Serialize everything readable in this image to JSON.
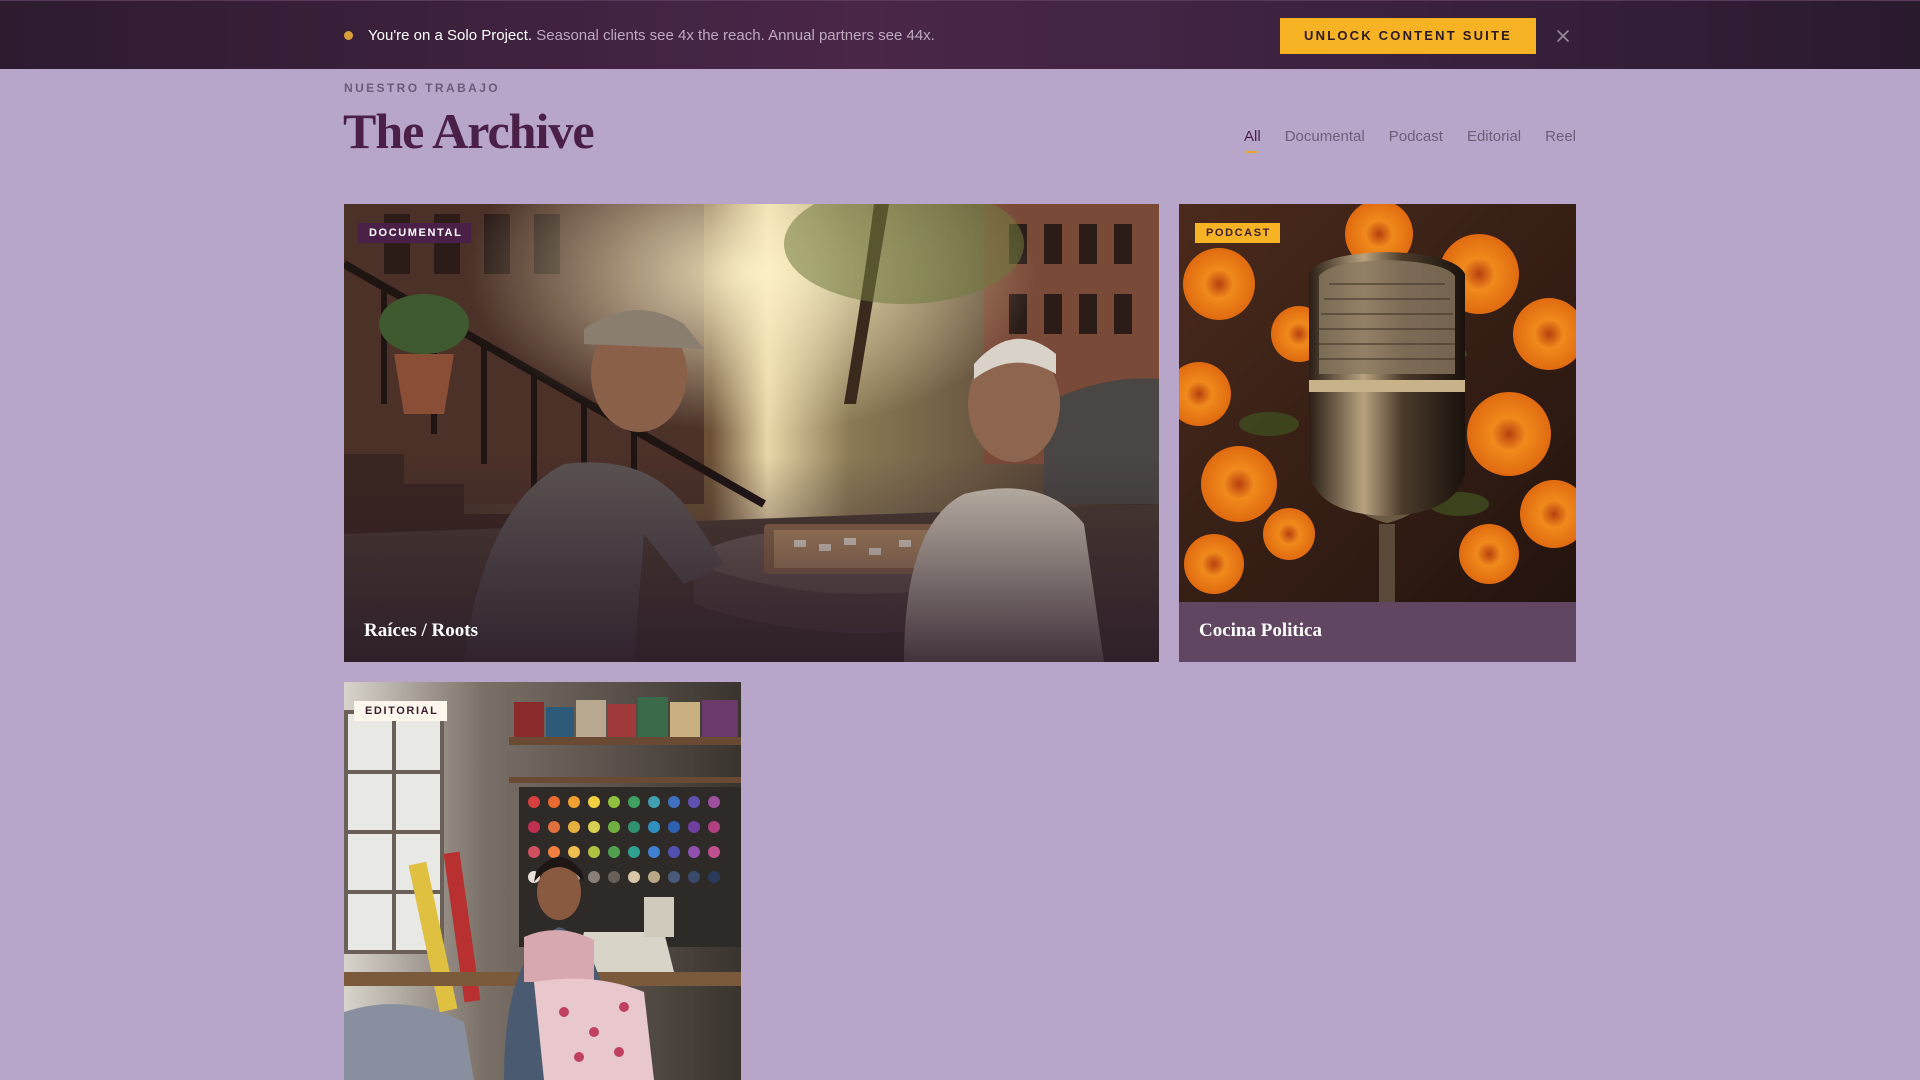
{
  "promo": {
    "strong_text": "You're on a Solo Project.",
    "detail_text": " Seasonal clients see 4x the reach. Annual partners see 44x.",
    "cta_label": "UNLOCK CONTENT SUITE",
    "close_icon": "close-icon",
    "accent_color": "#f7b324"
  },
  "header": {
    "eyebrow": "NUESTRO TRABAJO",
    "title": "The Archive"
  },
  "filters": {
    "active": "All",
    "tabs": [
      {
        "label": "All"
      },
      {
        "label": "Documental"
      },
      {
        "label": "Podcast"
      },
      {
        "label": "Editorial"
      },
      {
        "label": "Reel"
      }
    ]
  },
  "cards": [
    {
      "badge": "DOCUMENTAL",
      "title": "Raíces / Roots",
      "image": "two-elderly-men-playing-dominoes-on-street"
    },
    {
      "badge": "PODCAST",
      "title": "Cocina Politica",
      "image": "vintage-microphone-with-marigolds"
    },
    {
      "badge": "EDITORIAL",
      "title": "",
      "image": "woman-sewing-in-thread-workshop"
    }
  ],
  "colors": {
    "page_background": "#b7a6ca",
    "brand_plum": "#4a2048",
    "accent_gold": "#f7b324"
  }
}
